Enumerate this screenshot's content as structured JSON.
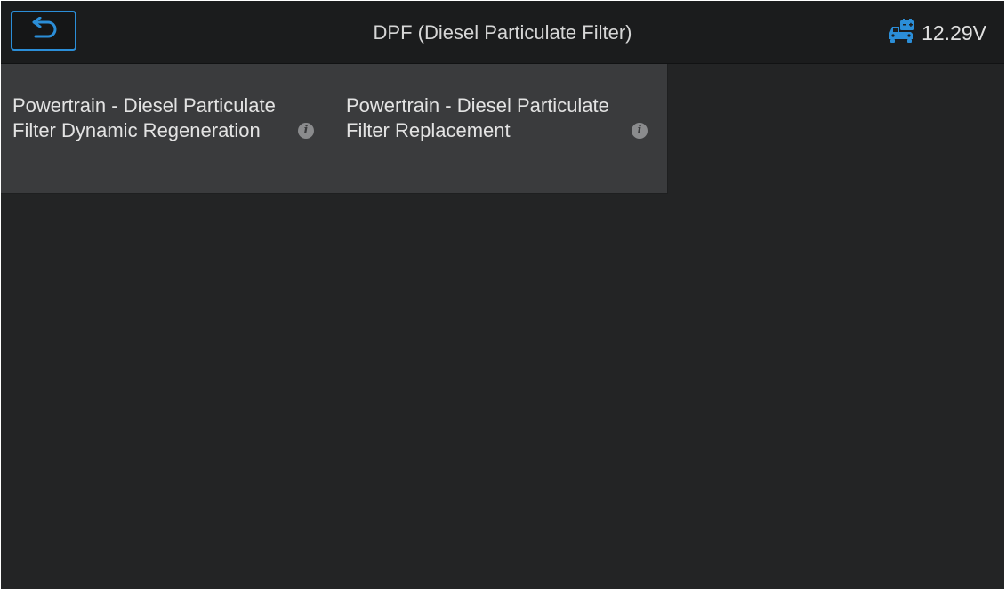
{
  "header": {
    "title": "DPF (Diesel Particulate Filter)",
    "back_icon": "back-arrow-icon",
    "battery": {
      "icon": "car-battery-icon",
      "voltage": "12.29V"
    }
  },
  "functions": [
    {
      "label": "Powertrain - Diesel Particulate Filter Dynamic Regeneration",
      "info_icon": "info-icon"
    },
    {
      "label": "Powertrain - Diesel Particulate Filter Replacement",
      "info_icon": "info-icon"
    }
  ],
  "colors": {
    "accent": "#2b8ed8",
    "background": "#232425",
    "header": "#1b1c1d",
    "tile": "#3a3b3d"
  }
}
